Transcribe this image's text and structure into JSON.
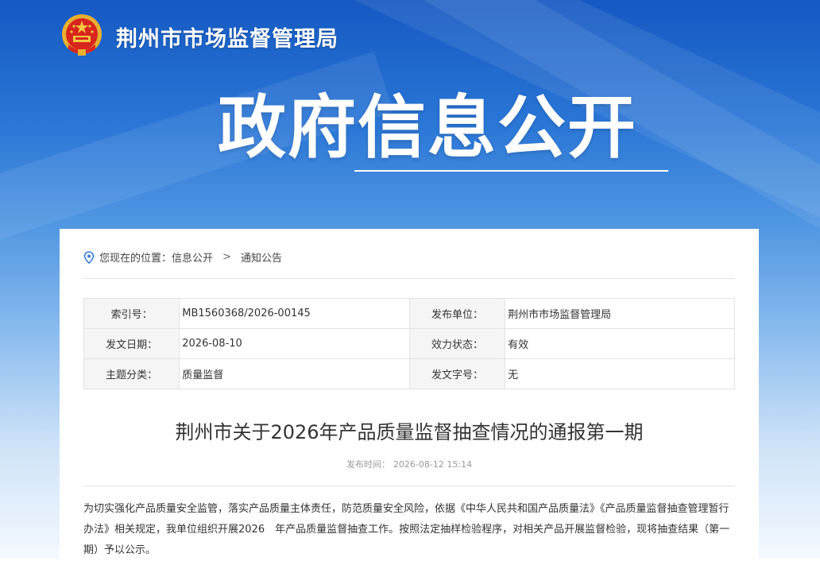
{
  "header": {
    "site_title": "荆州市市场监督管理局",
    "banner_title": "政府信息公开"
  },
  "breadcrumb": {
    "prefix": "您现在的位置：",
    "item1": "信息公开",
    "separator": ">",
    "item2": "通知公告"
  },
  "meta": {
    "index_label": "索引号：",
    "index_value": "MB1560368/2026-00145",
    "publisher_label": "发布单位：",
    "publisher_value": "荆州市市场监督管理局",
    "date_label": "发文日期：",
    "date_value": "2026-08-10",
    "status_label": "效力状态：",
    "status_value": "有效",
    "topic_label": "主题分类：",
    "topic_value": "质量监督",
    "docno_label": "发文字号：",
    "docno_value": "无"
  },
  "article": {
    "title": "荆州市关于2026年产品质量监督抽查情况的通报第一期",
    "publish_label": "发布时间：",
    "publish_time": "2026-08-12 15:14",
    "body": "为切实强化产品质量安全监管，落实产品质量主体责任，防范质量安全风险，依据《中华人民共和国产品质量法》《产品质量监督抽查管理暂行办法》相关规定，我单位组织开展2026　年产品质量监督抽查工作。按照法定抽样检验程序，对相关产品开展监督检验，现将抽查结果（第一期）予以公示。"
  },
  "colors": {
    "header_blue": "#1559c2",
    "text": "#333333"
  }
}
